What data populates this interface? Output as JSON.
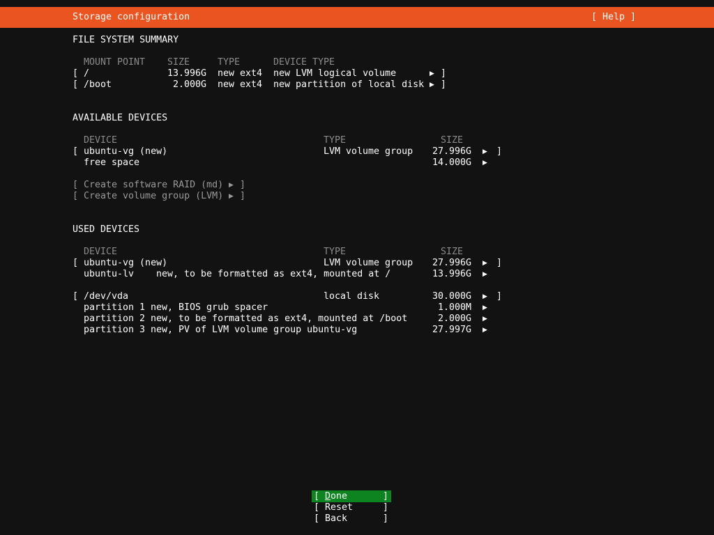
{
  "titlebar": {
    "title": "Storage configuration",
    "help": "[ Help ]"
  },
  "glyphs": {
    "open": "[",
    "close": "]",
    "arrow": "▶"
  },
  "filesystem": {
    "title": "FILE SYSTEM SUMMARY",
    "headers": {
      "mount": "MOUNT POINT",
      "size": "SIZE",
      "type": "TYPE",
      "device_type": "DEVICE TYPE"
    },
    "rows": [
      {
        "mount": "/",
        "size": "13.996G",
        "type": "new ext4",
        "device_type": "new LVM logical volume"
      },
      {
        "mount": "/boot",
        "size": "2.000G",
        "type": "new ext4",
        "device_type": "new partition of local disk"
      }
    ]
  },
  "available": {
    "title": "AVAILABLE DEVICES",
    "headers": {
      "device": "DEVICE",
      "type": "TYPE",
      "size": "SIZE"
    },
    "rows": [
      {
        "device": "ubuntu-vg (new)",
        "type": "LVM volume group",
        "size": "27.996G"
      },
      {
        "device": "free space",
        "size": "14.000G"
      }
    ],
    "actions": [
      {
        "label": "Create software RAID (md)"
      },
      {
        "label": "Create volume group (LVM)"
      }
    ]
  },
  "used": {
    "title": "USED DEVICES",
    "headers": {
      "device": "DEVICE",
      "type": "TYPE",
      "size": "SIZE"
    },
    "rows": [
      {
        "device": "ubuntu-vg (new)",
        "type": "LVM volume group",
        "size": "27.996G"
      },
      {
        "device": "ubuntu-lv",
        "desc": "new, to be formatted as ext4, mounted at /",
        "size": "13.996G"
      },
      {
        "device": "/dev/vda",
        "type": "local disk",
        "size": "30.000G"
      },
      {
        "device": "partition 1",
        "desc": "new, BIOS grub spacer",
        "size": "1.000M"
      },
      {
        "device": "partition 2",
        "desc": "new, to be formatted as ext4, mounted at /boot",
        "size": "2.000G"
      },
      {
        "device": "partition 3",
        "desc": "new, PV of LVM volume group ubuntu-vg",
        "size": "27.997G"
      }
    ]
  },
  "buttons": [
    {
      "label": "Done"
    },
    {
      "label": "Reset"
    },
    {
      "label": "Back"
    }
  ],
  "colors": {
    "accent_orange": "#E95420",
    "focus_green": "#0E8420",
    "background": "#121212",
    "text": "#FFFFFF",
    "muted": "#8A8A8A"
  }
}
